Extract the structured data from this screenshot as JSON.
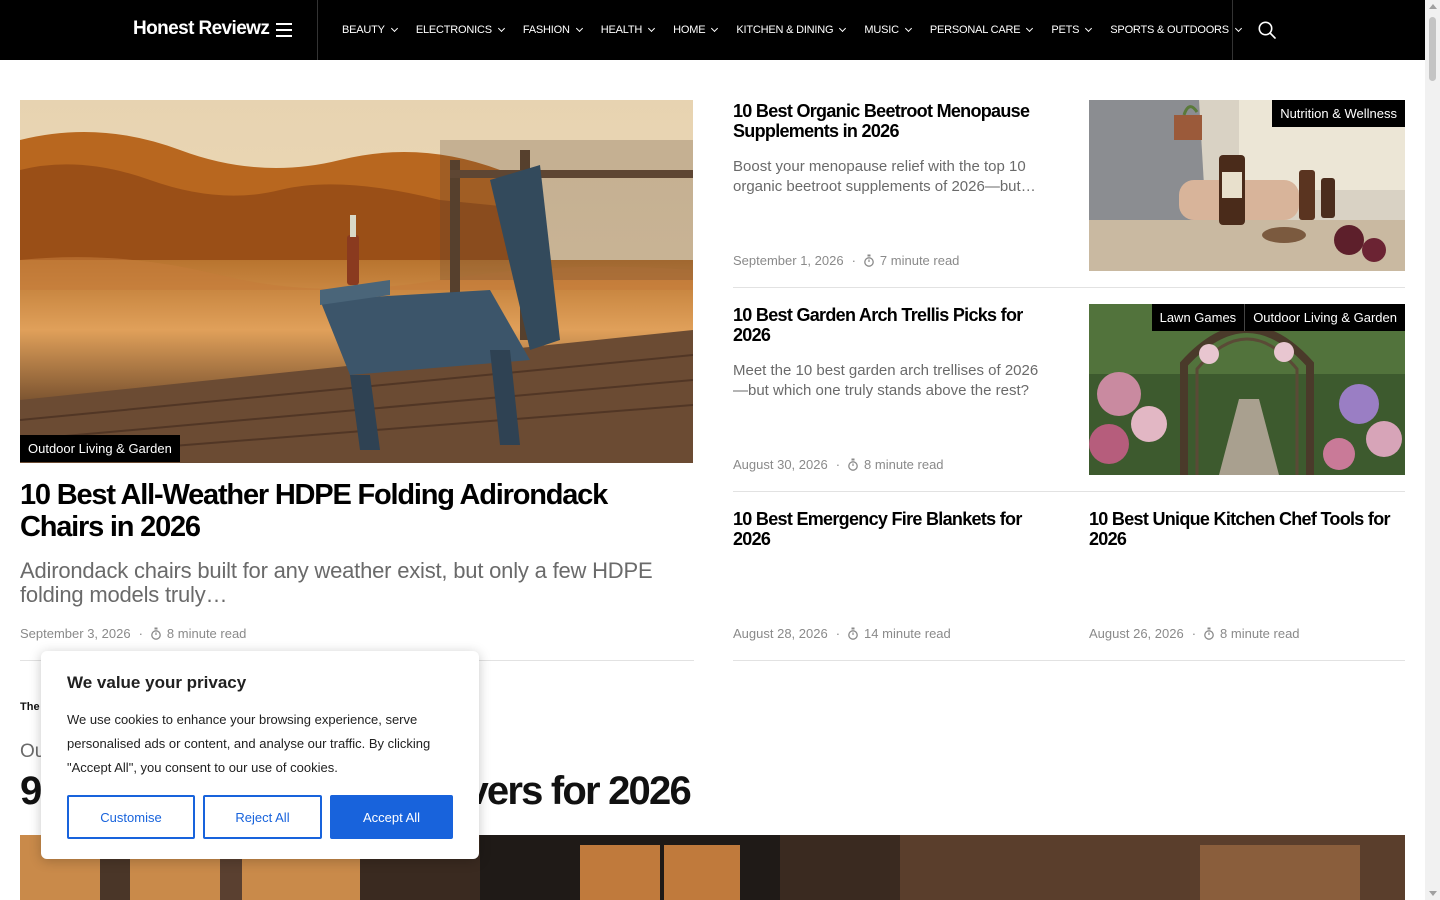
{
  "brand": "Honest Reviewz",
  "nav": [
    {
      "label": "BEAUTY"
    },
    {
      "label": "ELECTRONICS"
    },
    {
      "label": "FASHION"
    },
    {
      "label": "HEALTH"
    },
    {
      "label": "HOME"
    },
    {
      "label": "KITCHEN & DINING"
    },
    {
      "label": "MUSIC"
    },
    {
      "label": "PERSONAL CARE"
    },
    {
      "label": "PETS"
    },
    {
      "label": "SPORTS & OUTDOORS"
    }
  ],
  "icons": {
    "menu": "hamburger-icon",
    "search": "search-icon",
    "readtime": "stopwatch-icon",
    "chevron": "chevron-down-icon"
  },
  "featured": {
    "category": "Outdoor Living & Garden",
    "title": "10 Best All-Weather HDPE Folding Adirondack Chairs in 2026",
    "excerpt": "Adirondack chairs built for any weather exist, but only a few HDPE folding models truly…",
    "date": "September 3, 2026",
    "readtime": "8 minute read"
  },
  "posts": [
    {
      "title": "10 Best Organic Beetroot Menopause Supplements in 2026",
      "excerpt": "Boost your menopause relief with the top 10 organic beetroot supplements of 2026—but…",
      "date": "September 1, 2026",
      "readtime": "7 minute read",
      "categories": [
        "Nutrition & Wellness"
      ]
    },
    {
      "title": "10 Best Garden Arch Trellis Picks for 2026",
      "excerpt": "Meet the 10 best garden arch trellises of 2026—but which one truly stands above the rest?",
      "date": "August 30, 2026",
      "readtime": "8 minute read",
      "categories": [
        "Lawn Games",
        "Outdoor Living & Garden"
      ]
    },
    {
      "title": "10 Best Emergency Fire Blankets for 2026",
      "date": "August 28, 2026",
      "readtime": "14 minute read"
    },
    {
      "title": "10 Best Unique Kitchen Chef Tools for 2026",
      "date": "August 26, 2026",
      "readtime": "8 minute read"
    }
  ],
  "section": {
    "label": "The",
    "category": "Ou",
    "title_start": "9",
    "title_end": "vers for 2026"
  },
  "cookie": {
    "title": "We value your privacy",
    "body": "We use cookies to enhance your browsing experience, serve personalised ads or content, and analyse our traffic. By clicking \"Accept All\", you consent to our use of cookies.",
    "customise": "Customise",
    "reject": "Reject All",
    "accept": "Accept All"
  },
  "colors": {
    "header": "#000000",
    "accent": "#1863dc",
    "meta": "#8a8a8a"
  }
}
